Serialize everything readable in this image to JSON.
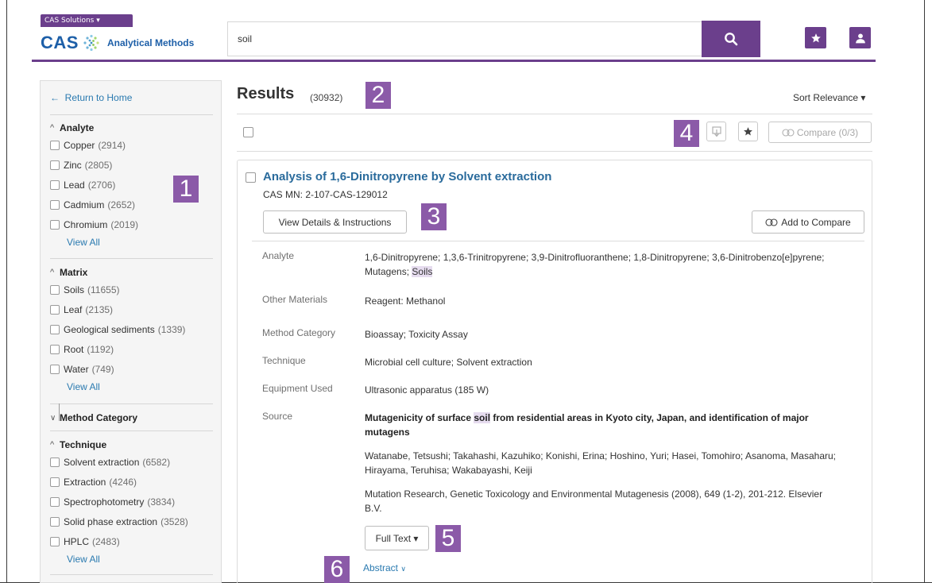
{
  "header": {
    "solutions_label": "CAS Solutions",
    "logo_text": "CAS",
    "logo_subtitle": "Analytical Methods",
    "search_value": "soil",
    "accent_color": "#6b3f8c",
    "brand_color": "#1d5fa8"
  },
  "badges": [
    "1",
    "2",
    "3",
    "4",
    "5",
    "6"
  ],
  "sidebar": {
    "return_label": "Return to Home",
    "analyte": {
      "title": "Analyte",
      "items": [
        {
          "label": "Copper",
          "count": "(2914)"
        },
        {
          "label": "Zinc",
          "count": "(2805)"
        },
        {
          "label": "Lead",
          "count": "(2706)"
        },
        {
          "label": "Cadmium",
          "count": "(2652)"
        },
        {
          "label": "Chromium",
          "count": "(2019)"
        }
      ],
      "view_all": "View All"
    },
    "matrix": {
      "title": "Matrix",
      "items": [
        {
          "label": "Soils",
          "count": "(11655)"
        },
        {
          "label": "Leaf",
          "count": "(2135)"
        },
        {
          "label": "Geological sediments",
          "count": "(1339)"
        },
        {
          "label": "Root",
          "count": "(1192)"
        },
        {
          "label": "Water",
          "count": "(749)"
        }
      ],
      "view_all": "View All"
    },
    "method_category": {
      "title": "Method Category"
    },
    "technique": {
      "title": "Technique",
      "items": [
        {
          "label": "Solvent extraction",
          "count": "(6582)"
        },
        {
          "label": "Extraction",
          "count": "(4246)"
        },
        {
          "label": "Spectrophotometry",
          "count": "(3834)"
        },
        {
          "label": "Solid phase extraction",
          "count": "(3528)"
        },
        {
          "label": "HPLC",
          "count": "(2483)"
        }
      ],
      "view_all": "View All"
    }
  },
  "results": {
    "title": "Results",
    "count": "(30932)",
    "sort_label": "Sort Relevance",
    "compare_label": "Compare (0/3)"
  },
  "card": {
    "title": "Analysis of 1,6-Dinitropyrene by Solvent extraction",
    "cas_mn": "CAS MN: 2-107-CAS-129012",
    "details_button": "View Details & Instructions",
    "add_compare_button": "Add to Compare",
    "fields": {
      "analyte_label": "Analyte",
      "analyte_value": "1,6-Dinitropyrene; 1,3,6-Trinitropyrene; 3,9-Dinitrofluoranthene; 1,8-Dinitropyrene; 3,6-Dinitrobenzo[e]pyrene; Mutagens;",
      "analyte_highlight": "Soils",
      "other_materials_label": "Other Materials",
      "other_materials_value": "Reagent: Methanol",
      "method_category_label": "Method Category",
      "method_category_value": "Bioassay; Toxicity Assay",
      "technique_label": "Technique",
      "technique_value": "Microbial cell culture; Solvent extraction",
      "equipment_label": "Equipment Used",
      "equipment_value": "Ultrasonic apparatus (185 W)",
      "source_label": "Source",
      "source_title_pre": "Mutagenicity of surface",
      "source_title_hl": "soil",
      "source_title_post": "from residential areas in Kyoto city, Japan, and identification of major mutagens",
      "source_authors": "Watanabe, Tetsushi; Takahashi, Kazuhiko; Konishi, Erina; Hoshino, Yuri; Hasei, Tomohiro; Asanoma, Masaharu; Hirayama, Teruhisa; Wakabayashi, Keiji",
      "source_journal": "Mutation Research, Genetic Toxicology and Environmental Mutagenesis (2008), 649 (1-2), 201-212. Elsevier B.V."
    },
    "full_text_button": "Full Text",
    "abstract_link": "Abstract"
  }
}
